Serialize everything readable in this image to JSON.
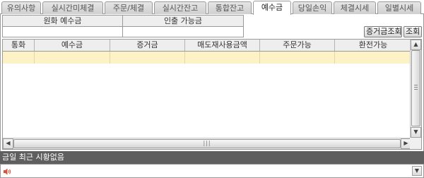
{
  "tabs": [
    {
      "label": "유의사항",
      "active": false
    },
    {
      "label": "실시간미체결",
      "active": false
    },
    {
      "label": "주문/체결",
      "active": false
    },
    {
      "label": "실시간잔고",
      "active": false
    },
    {
      "label": "통합잔고",
      "active": false
    },
    {
      "label": "예수금",
      "active": true
    },
    {
      "label": "당일손익",
      "active": false
    },
    {
      "label": "체결시세",
      "active": false
    },
    {
      "label": "일별시세",
      "active": false
    }
  ],
  "summary": {
    "deposit_label": "원화 예수금",
    "deposit_value": "",
    "withdrawable_label": "인출 가능금",
    "withdrawable_value": ""
  },
  "buttons": {
    "margin_query": "증거금조회",
    "query": "조회"
  },
  "grid": {
    "columns": [
      "통화",
      "예수금",
      "증거금",
      "매도재사용금액",
      "주문가능",
      "환전가능"
    ],
    "rows": [
      [
        "",
        "",
        "",
        "",
        "",
        ""
      ]
    ]
  },
  "status": {
    "message": "금일 최근 시황없음"
  },
  "message_bar": {
    "value": ""
  },
  "colors": {
    "selected_row": "#fdf1c6",
    "status_bar": "#5f5f5f",
    "header_bg": "#eeeeee"
  }
}
